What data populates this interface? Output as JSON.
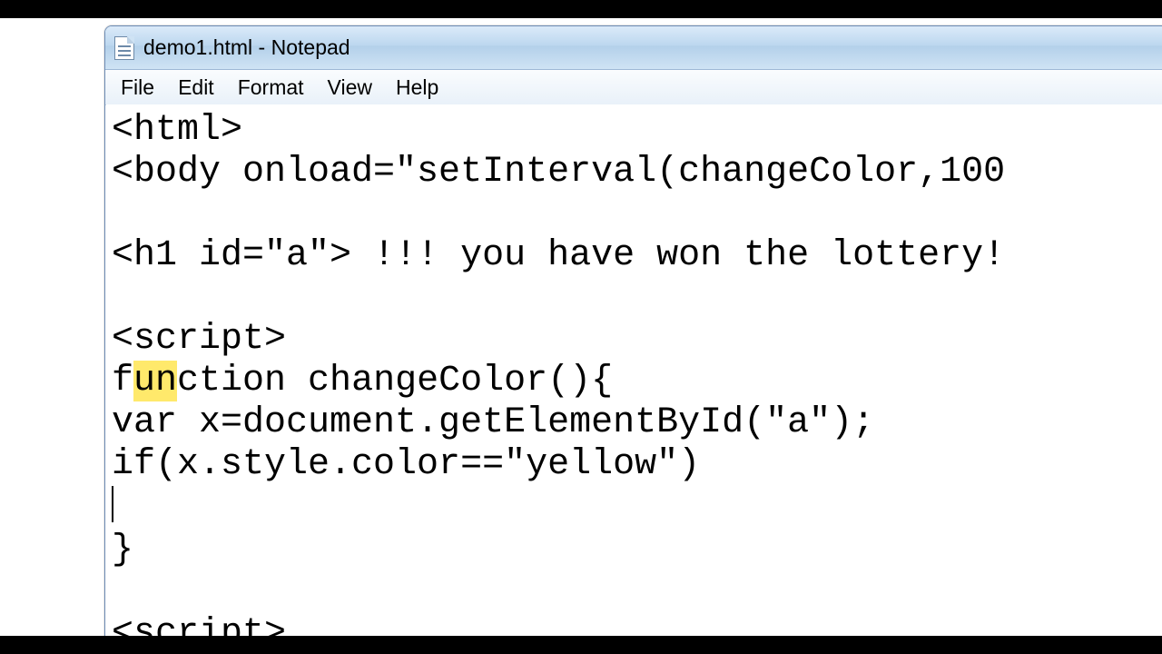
{
  "window": {
    "title": "demo1.html - Notepad"
  },
  "menubar": {
    "items": [
      "File",
      "Edit",
      "Format",
      "View",
      "Help"
    ]
  },
  "editor": {
    "line1": "<html>",
    "line2": "<body onload=\"setInterval(changeColor,100",
    "line3": "",
    "line4": "<h1 id=\"a\"> !!! you have won the lottery!",
    "line5": "",
    "line6": "<script>",
    "line7_a": "f",
    "line7_hl": "un",
    "line7_b": "ction changeColor(){",
    "line8": "var x=document.getElementById(\"a\");",
    "line9": "if(x.style.color==\"yellow\")",
    "line10": "",
    "line11": "}",
    "line12": "",
    "line13": "<script>"
  }
}
